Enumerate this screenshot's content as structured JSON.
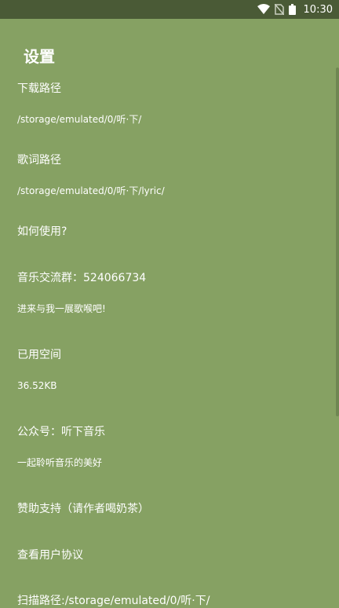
{
  "status_bar": {
    "time": "10:30"
  },
  "page": {
    "title": "设置"
  },
  "settings": [
    {
      "title": "下载路径",
      "subtitle": "/storage/emulated/0/听·下/"
    },
    {
      "title": "歌词路径",
      "subtitle": "/storage/emulated/0/听·下/lyric/"
    },
    {
      "title": "如何使用?"
    },
    {
      "title": "音乐交流群：524066734",
      "subtitle": "进来与我一展歌喉吧!"
    },
    {
      "title": "已用空间",
      "subtitle": "36.52KB"
    },
    {
      "title": "公众号：听下音乐",
      "subtitle": "一起聆听音乐的美好"
    },
    {
      "title": "赞助支持（请作者喝奶茶）"
    },
    {
      "title": "查看用户协议"
    },
    {
      "title": "扫描路径:/storage/emulated/0/听·下/"
    }
  ],
  "colors": {
    "background": "#86a163",
    "status_bar": "#4a5a36",
    "text": "#ffffff"
  },
  "icons": [
    "wifi-icon",
    "no-sim-icon",
    "battery-icon"
  ]
}
